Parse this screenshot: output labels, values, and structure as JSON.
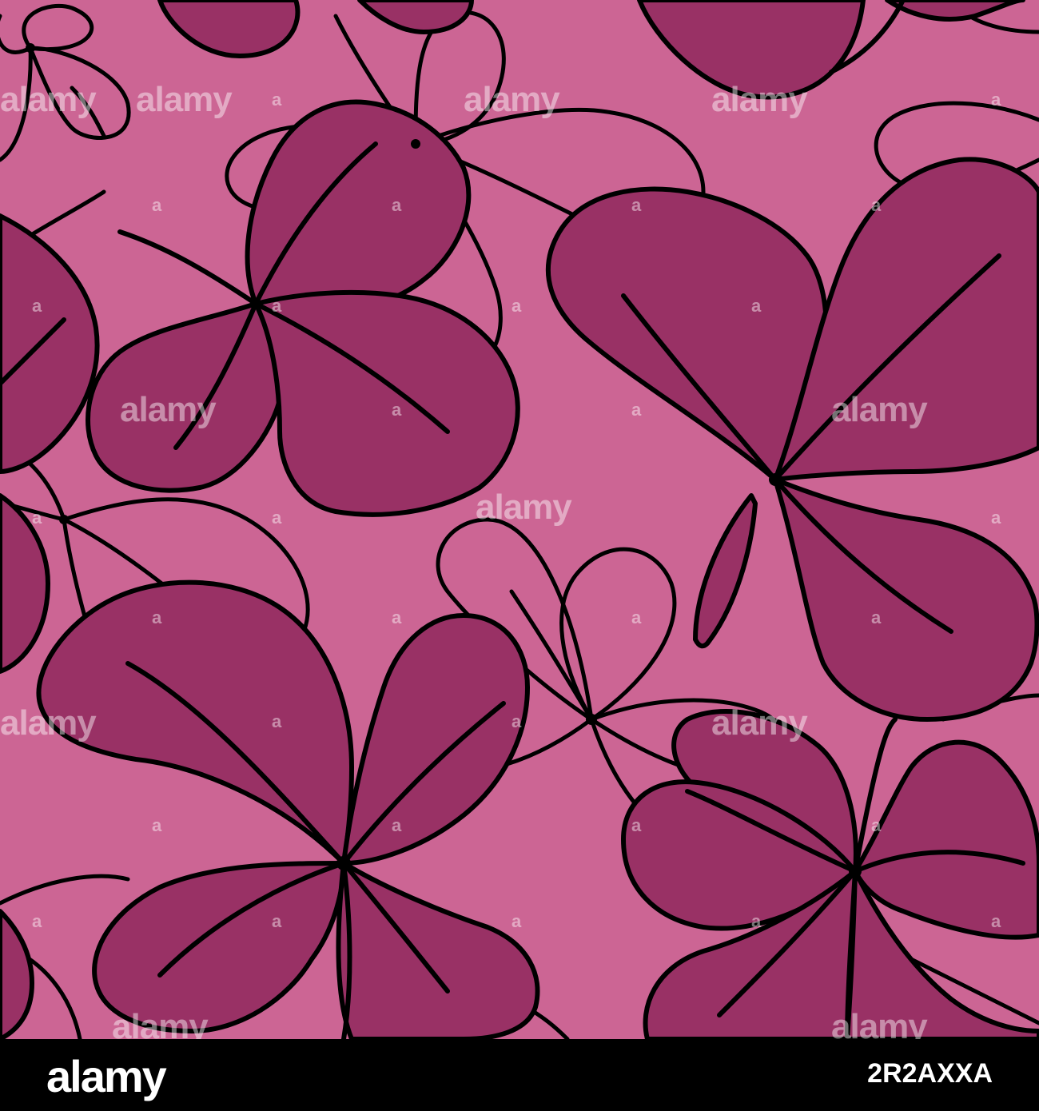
{
  "colors": {
    "background": "#cc6594",
    "leaf_fill": "#993165",
    "outline": "#000000",
    "footer_bg": "#000000",
    "footer_text": "#ffffff"
  },
  "watermark": {
    "text": "alamy"
  },
  "footer": {
    "logo": "alamy",
    "image_id": "2R2AXXA"
  }
}
